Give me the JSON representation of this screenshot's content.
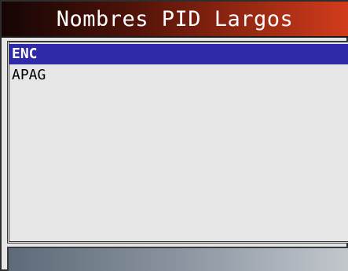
{
  "title": "Nombres PID Largos",
  "menu": {
    "items": [
      {
        "label": "ENC",
        "selected": true
      },
      {
        "label": "APAG",
        "selected": false
      }
    ]
  },
  "colors": {
    "selection": "#2e2aa8",
    "title_gradient_start": "#150505",
    "title_gradient_end": "#d23c1c",
    "background": "#e6e6e6"
  }
}
